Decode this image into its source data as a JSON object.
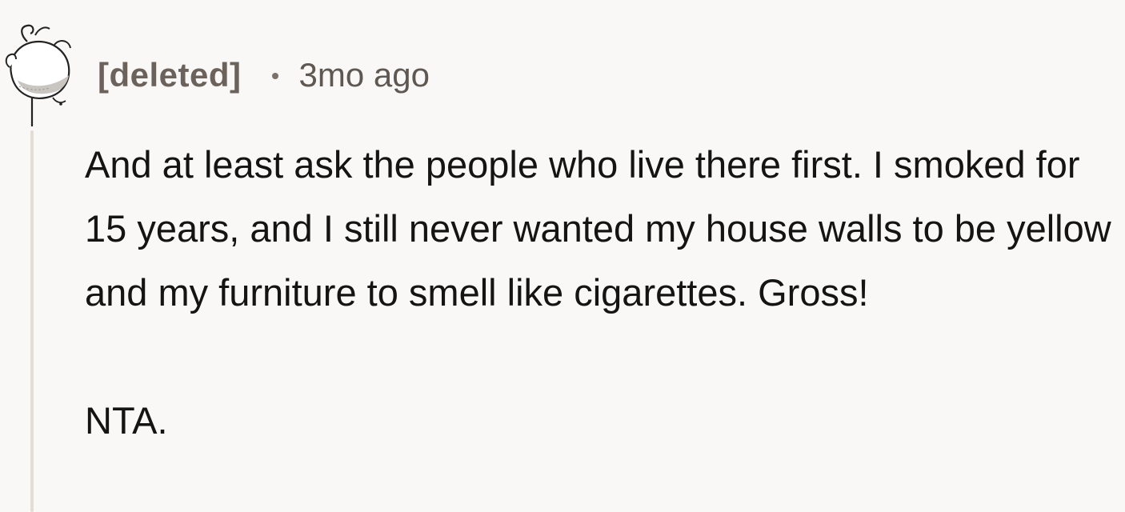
{
  "comment": {
    "author": "[deleted]",
    "timestamp": "3mo ago",
    "paragraphs": [
      "And at least ask the people who live there first. I smoked for 15 years, and I still never wanted my house walls to be yellow and my furniture to smell like cigarettes. Gross!",
      "NTA."
    ]
  },
  "avatar": {
    "icon": "snoo-avatar-icon",
    "fill": "#ffffff",
    "stroke": "#222222",
    "shade": "#c9c6c2"
  },
  "colors": {
    "background": "#f9f8f6",
    "thread_line": "#e4ddd6",
    "author_text": "#6b625c",
    "meta_text": "#5f5852",
    "body_text": "#141414"
  }
}
